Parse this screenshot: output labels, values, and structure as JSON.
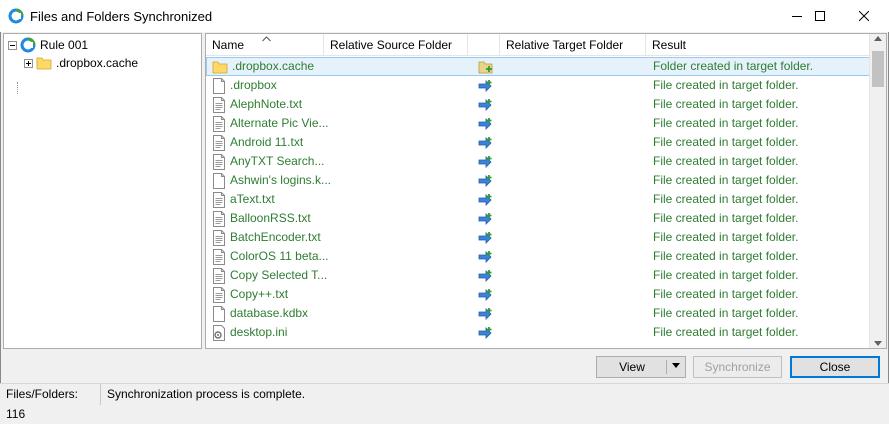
{
  "window": {
    "title": "Files and Folders Synchronized",
    "controls": [
      "minimize",
      "maximize",
      "close"
    ]
  },
  "tree": {
    "root": {
      "label": "Rule 001",
      "expanded": true
    },
    "children": [
      {
        "label": ".dropbox.cache",
        "expanded": false
      }
    ]
  },
  "list": {
    "columns": [
      "Name",
      "Relative Source Folder",
      "",
      "Relative Target Folder",
      "Result"
    ],
    "sorted_column": "Name",
    "rows": [
      {
        "name": ".dropbox.cache",
        "icon": "folder-icon",
        "source": "",
        "target": "",
        "action_icon": "folder-add-icon",
        "result": "Folder created in target folder."
      },
      {
        "name": ".dropbox",
        "icon": "file-icon",
        "source": "",
        "target": "",
        "action_icon": "copy-arrow-icon",
        "result": "File created in target folder."
      },
      {
        "name": "AlephNote.txt",
        "icon": "text-file-icon",
        "source": "",
        "target": "",
        "action_icon": "copy-arrow-icon",
        "result": "File created in target folder."
      },
      {
        "name": "Alternate Pic Vie...",
        "icon": "text-file-icon",
        "source": "",
        "target": "",
        "action_icon": "copy-arrow-icon",
        "result": "File created in target folder."
      },
      {
        "name": "Android 11.txt",
        "icon": "text-file-icon",
        "source": "",
        "target": "",
        "action_icon": "copy-arrow-icon",
        "result": "File created in target folder."
      },
      {
        "name": "AnyTXT Search...",
        "icon": "text-file-icon",
        "source": "",
        "target": "",
        "action_icon": "copy-arrow-icon",
        "result": "File created in target folder."
      },
      {
        "name": "Ashwin's logins.k...",
        "icon": "file-icon",
        "source": "",
        "target": "",
        "action_icon": "copy-arrow-icon",
        "result": "File created in target folder."
      },
      {
        "name": "aText.txt",
        "icon": "text-file-icon",
        "source": "",
        "target": "",
        "action_icon": "copy-arrow-icon",
        "result": "File created in target folder."
      },
      {
        "name": "BalloonRSS.txt",
        "icon": "text-file-icon",
        "source": "",
        "target": "",
        "action_icon": "copy-arrow-icon",
        "result": "File created in target folder."
      },
      {
        "name": "BatchEncoder.txt",
        "icon": "text-file-icon",
        "source": "",
        "target": "",
        "action_icon": "copy-arrow-icon",
        "result": "File created in target folder."
      },
      {
        "name": "ColorOS 11 beta...",
        "icon": "text-file-icon",
        "source": "",
        "target": "",
        "action_icon": "copy-arrow-icon",
        "result": "File created in target folder."
      },
      {
        "name": "Copy Selected T...",
        "icon": "text-file-icon",
        "source": "",
        "target": "",
        "action_icon": "copy-arrow-icon",
        "result": "File created in target folder."
      },
      {
        "name": "Copy++.txt",
        "icon": "text-file-icon",
        "source": "",
        "target": "",
        "action_icon": "copy-arrow-icon",
        "result": "File created in target folder."
      },
      {
        "name": "database.kdbx",
        "icon": "file-icon",
        "source": "",
        "target": "",
        "action_icon": "copy-arrow-icon",
        "result": "File created in target folder."
      },
      {
        "name": "desktop.ini",
        "icon": "settings-file-icon",
        "source": "",
        "target": "",
        "action_icon": "copy-arrow-icon",
        "result": "File created in target folder."
      }
    ]
  },
  "buttons": {
    "view": "View",
    "synchronize": "Synchronize",
    "close": "Close"
  },
  "status": {
    "count": "Files/Folders: 116",
    "message": "Synchronization process is complete."
  },
  "colors": {
    "result_text": "#2e7d32",
    "selection": "#e5f1fb",
    "accent": "#0078d7"
  }
}
